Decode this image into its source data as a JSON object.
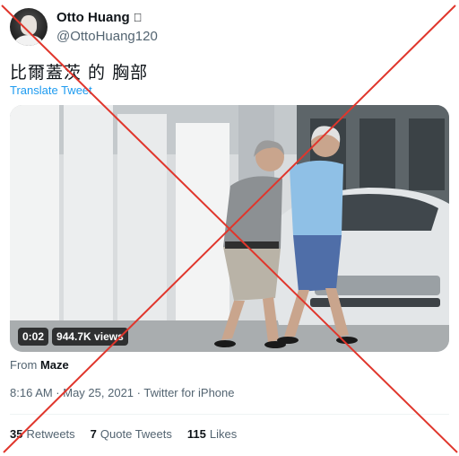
{
  "author": {
    "name": "Otto Huang",
    "handle": "@OttoHuang120",
    "badge_icon": "apple-icon"
  },
  "tweet": {
    "text": "比爾蓋茨 的 胸部",
    "translate_label": "Translate Tweet"
  },
  "video": {
    "duration": "0:02",
    "views": "944.7K views"
  },
  "source": {
    "prefix": "From",
    "name": "Maze"
  },
  "meta": {
    "timestamp": "8:16 AM · May 25, 2021 · Twitter for iPhone"
  },
  "stats": [
    {
      "count": "35",
      "label": "Retweets"
    },
    {
      "count": "7",
      "label": "Quote Tweets"
    },
    {
      "count": "115",
      "label": "Likes"
    }
  ],
  "overlay": {
    "cross_color": "#e0362c"
  },
  "colors": {
    "link": "#1d9bf0",
    "secondary_text": "#536471"
  }
}
